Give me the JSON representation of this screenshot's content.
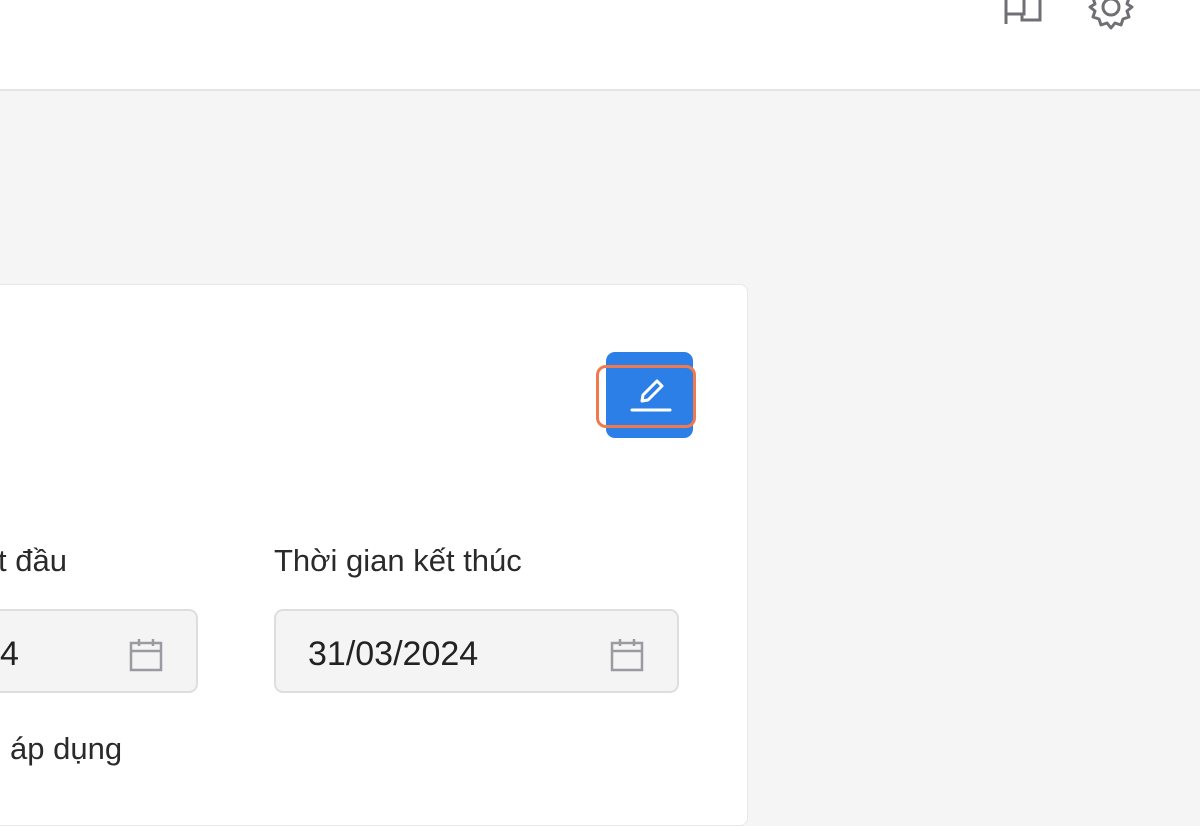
{
  "header": {
    "icons": [
      "flag-icon",
      "gear-icon"
    ]
  },
  "card": {
    "edit_button": {
      "icon": "edit-icon",
      "accent_color": "#2d7fe8",
      "highlight_color": "#f07a4e"
    },
    "start_time": {
      "label": "t đầu",
      "value": "4"
    },
    "end_time": {
      "label": "Thời gian kết thúc",
      "value": "31/03/2024"
    },
    "applied_label": "áp dụng"
  }
}
